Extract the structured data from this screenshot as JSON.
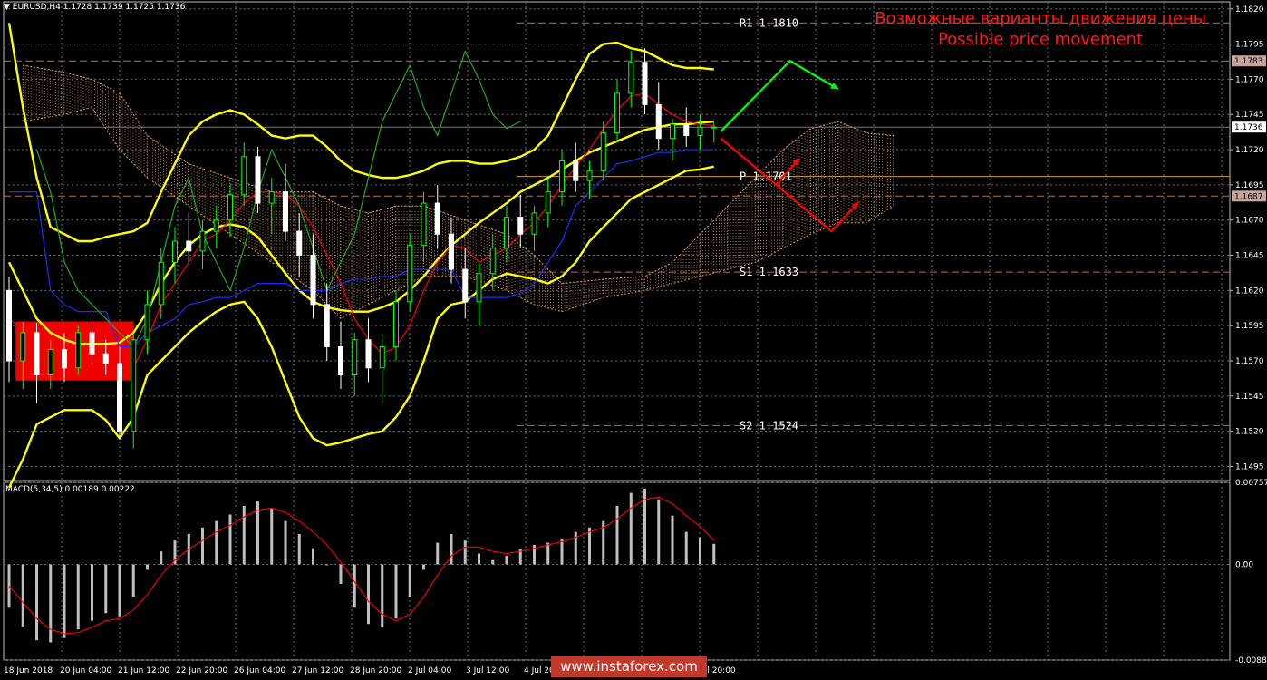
{
  "header": {
    "symbol_line": "EURUSD,H4  1.1728 1.1739 1.1725 1.1736",
    "macd_line": "MACD(5,34,5) 0.00189 0.00222"
  },
  "headline": {
    "ru": "Возможные варианты движения цены",
    "en": "Possible price movement"
  },
  "watermark": "www.instaforex.com",
  "colors": {
    "background": "#000000",
    "bull_candle": "#00ff00",
    "bear_candle": "#ffffff",
    "bollinger": "#ffff00",
    "kijun": "#1e2cff",
    "tenkan": "#ff0000",
    "chikou": "#22aa22",
    "cloud": "#f4a460",
    "pivot_line": "#cc9933",
    "sr_lines": "#b07050",
    "macd_hist": "#bfbfbf",
    "macd_signal": "#ff0000",
    "arrow_up": "#00ff00",
    "arrow_down": "#ff0000",
    "highlight_box": "#ff0000"
  },
  "chart_data": {
    "type": "candlestick",
    "main_axis": {
      "ylim": [
        1.1485,
        1.1825
      ],
      "ticks": [
        "1.1820",
        "1.1795",
        "1.1770",
        "1.1745",
        "1.1720",
        "1.1695",
        "1.1670",
        "1.1645",
        "1.1620",
        "1.1595",
        "1.1570",
        "1.1545",
        "1.1520",
        "1.1495"
      ],
      "current_price": "1.1736",
      "price_tags": [
        "1.1783",
        "1.1687"
      ]
    },
    "macd_axis": {
      "ylim": [
        -0.00883,
        0.00757
      ],
      "ticks": [
        "0.00757",
        "0.00",
        "-0.00883"
      ]
    },
    "x_labels": [
      "18 Jun 2018",
      "20 Jun 04:00",
      "21 Jun 12:00",
      "22 Jun 20:00",
      "26 Jun 04:00",
      "27 Jun 12:00",
      "28 Jun 20:00",
      "2 Jul 04:00",
      "3 Jul 12:00",
      "4 Jul 20",
      "Jul 20:00"
    ],
    "pivots": [
      {
        "label": "R1 1.1810",
        "value": 1.181
      },
      {
        "label": "P  1.1701",
        "value": 1.1701
      },
      {
        "label": "S1 1.1633",
        "value": 1.1633
      },
      {
        "label": "S2 1.1524",
        "value": 1.1524
      }
    ],
    "candles": [
      [
        1.162,
        1.163,
        1.1555,
        1.157
      ],
      [
        1.157,
        1.1598,
        1.155,
        1.159
      ],
      [
        1.159,
        1.1597,
        1.154,
        1.156
      ],
      [
        1.156,
        1.1585,
        1.155,
        1.1578
      ],
      [
        1.1578,
        1.159,
        1.1555,
        1.1565
      ],
      [
        1.1565,
        1.1595,
        1.156,
        1.159
      ],
      [
        1.159,
        1.16,
        1.1568,
        1.1575
      ],
      [
        1.1575,
        1.1585,
        1.156,
        1.1568
      ],
      [
        1.1568,
        1.158,
        1.1515,
        1.152
      ],
      [
        1.152,
        1.159,
        1.1508,
        1.1585
      ],
      [
        1.1585,
        1.162,
        1.1575,
        1.161
      ],
      [
        1.161,
        1.165,
        1.16,
        1.164
      ],
      [
        1.164,
        1.1665,
        1.1625,
        1.1655
      ],
      [
        1.1655,
        1.1675,
        1.164,
        1.1648
      ],
      [
        1.1648,
        1.167,
        1.1635,
        1.1662
      ],
      [
        1.1662,
        1.168,
        1.165,
        1.167
      ],
      [
        1.167,
        1.1695,
        1.1658,
        1.1688
      ],
      [
        1.1688,
        1.1725,
        1.168,
        1.1715
      ],
      [
        1.1715,
        1.1722,
        1.1675,
        1.1682
      ],
      [
        1.1682,
        1.17,
        1.166,
        1.169
      ],
      [
        1.169,
        1.171,
        1.1655,
        1.1662
      ],
      [
        1.1662,
        1.1675,
        1.163,
        1.1645
      ],
      [
        1.1645,
        1.166,
        1.16,
        1.161
      ],
      [
        1.161,
        1.1625,
        1.157,
        1.158
      ],
      [
        1.158,
        1.1598,
        1.155,
        1.156
      ],
      [
        1.156,
        1.159,
        1.1545,
        1.1585
      ],
      [
        1.1585,
        1.16,
        1.1555,
        1.1565
      ],
      [
        1.1565,
        1.1588,
        1.154,
        1.158
      ],
      [
        1.158,
        1.162,
        1.157,
        1.1612
      ],
      [
        1.1612,
        1.166,
        1.1605,
        1.1652
      ],
      [
        1.1652,
        1.169,
        1.164,
        1.1682
      ],
      [
        1.1682,
        1.1695,
        1.165,
        1.166
      ],
      [
        1.166,
        1.1672,
        1.1625,
        1.1635
      ],
      [
        1.1635,
        1.165,
        1.16,
        1.1612
      ],
      [
        1.1612,
        1.164,
        1.1595,
        1.1632
      ],
      [
        1.1632,
        1.166,
        1.162,
        1.165
      ],
      [
        1.165,
        1.168,
        1.164,
        1.1672
      ],
      [
        1.1672,
        1.1688,
        1.165,
        1.166
      ],
      [
        1.166,
        1.168,
        1.1648,
        1.1675
      ],
      [
        1.1675,
        1.17,
        1.1665,
        1.169
      ],
      [
        1.169,
        1.172,
        1.168,
        1.1712
      ],
      [
        1.1712,
        1.1725,
        1.169,
        1.1698
      ],
      [
        1.1698,
        1.1712,
        1.1685,
        1.1705
      ],
      [
        1.1705,
        1.174,
        1.1698,
        1.1732
      ],
      [
        1.1732,
        1.177,
        1.1725,
        1.176
      ],
      [
        1.176,
        1.179,
        1.175,
        1.1782
      ],
      [
        1.1782,
        1.1792,
        1.1745,
        1.1752
      ],
      [
        1.1752,
        1.1768,
        1.172,
        1.1728
      ],
      [
        1.1728,
        1.1742,
        1.1712,
        1.1738
      ],
      [
        1.1738,
        1.175,
        1.1722,
        1.173
      ],
      [
        1.173,
        1.1745,
        1.172,
        1.1736
      ],
      [
        1.1736,
        1.1739,
        1.1725,
        1.1736
      ]
    ],
    "macd_hist": [
      -0.004,
      -0.0058,
      -0.007,
      -0.0072,
      -0.0068,
      -0.006,
      -0.0052,
      -0.0045,
      -0.0048,
      -0.003,
      -0.0005,
      0.0012,
      0.0022,
      0.0028,
      0.0034,
      0.004,
      0.0046,
      0.0054,
      0.0058,
      0.0052,
      0.004,
      0.0028,
      0.0015,
      0.0,
      -0.0018,
      -0.004,
      -0.0055,
      -0.0058,
      -0.005,
      -0.003,
      -0.0005,
      0.002,
      0.0028,
      0.0022,
      0.001,
      0.0004,
      0.0008,
      0.0014,
      0.0018,
      0.002,
      0.0024,
      0.003,
      0.0034,
      0.004,
      0.0054,
      0.0066,
      0.007,
      0.006,
      0.0045,
      0.003,
      0.0025,
      0.0019
    ],
    "macd_signal": [
      -0.002,
      -0.0035,
      -0.005,
      -0.006,
      -0.0064,
      -0.0063,
      -0.0058,
      -0.0052,
      -0.005,
      -0.0042,
      -0.0028,
      -0.001,
      0.0004,
      0.0014,
      0.0022,
      0.003,
      0.0036,
      0.0044,
      0.005,
      0.0052,
      0.0048,
      0.004,
      0.003,
      0.0018,
      0.0002,
      -0.0016,
      -0.0034,
      -0.0046,
      -0.0052,
      -0.0046,
      -0.003,
      -0.001,
      0.0008,
      0.0016,
      0.0016,
      0.0012,
      0.001,
      0.0012,
      0.0015,
      0.0018,
      0.0021,
      0.0025,
      0.003,
      0.0034,
      0.0042,
      0.0052,
      0.006,
      0.0062,
      0.0056,
      0.0045,
      0.0035,
      0.0022
    ],
    "bollinger_upper": [
      1.181,
      1.175,
      1.17,
      1.1665,
      1.166,
      1.1655,
      1.1655,
      1.1658,
      1.166,
      1.1662,
      1.1668,
      1.169,
      1.171,
      1.173,
      1.174,
      1.1745,
      1.1748,
      1.1745,
      1.1738,
      1.173,
      1.1728,
      1.173,
      1.173,
      1.1722,
      1.1712,
      1.1705,
      1.1702,
      1.17,
      1.17,
      1.1702,
      1.1705,
      1.171,
      1.1712,
      1.1712,
      1.171,
      1.171,
      1.1712,
      1.1715,
      1.172,
      1.173,
      1.175,
      1.177,
      1.1788,
      1.1795,
      1.1796,
      1.1792,
      1.179,
      1.1785,
      1.178,
      1.1778,
      1.1778,
      1.1777
    ],
    "bollinger_mid": [
      1.164,
      1.162,
      1.16,
      1.159,
      1.1585,
      1.1582,
      1.1582,
      1.1582,
      1.1583,
      1.159,
      1.1605,
      1.1625,
      1.164,
      1.1652,
      1.166,
      1.1665,
      1.1667,
      1.1665,
      1.1658,
      1.1645,
      1.1632,
      1.162,
      1.1612,
      1.1608,
      1.1606,
      1.1605,
      1.1605,
      1.1608,
      1.1612,
      1.162,
      1.163,
      1.1642,
      1.1652,
      1.166,
      1.1668,
      1.1675,
      1.1682,
      1.169,
      1.1695,
      1.17,
      1.1706,
      1.1712,
      1.1718,
      1.1722,
      1.1726,
      1.173,
      1.1734,
      1.1736,
      1.1738,
      1.1738,
      1.1739,
      1.174
    ],
    "bollinger_lower": [
      1.148,
      1.15,
      1.1525,
      1.153,
      1.1535,
      1.1535,
      1.1535,
      1.1528,
      1.1515,
      1.153,
      1.156,
      1.157,
      1.158,
      1.159,
      1.1598,
      1.1605,
      1.161,
      1.1612,
      1.16,
      1.158,
      1.1555,
      1.153,
      1.1515,
      1.151,
      1.1512,
      1.1515,
      1.1518,
      1.152,
      1.153,
      1.1545,
      1.157,
      1.16,
      1.161,
      1.1612,
      1.162,
      1.1628,
      1.1632,
      1.163,
      1.1628,
      1.1625,
      1.163,
      1.164,
      1.1655,
      1.1665,
      1.1675,
      1.1685,
      1.169,
      1.1695,
      1.17,
      1.1705,
      1.1706,
      1.1708
    ],
    "kijun": [
      1.169,
      1.169,
      1.169,
      1.162,
      1.161,
      1.1605,
      1.1605,
      1.1605,
      1.158,
      1.158,
      1.159,
      1.1595,
      1.16,
      1.161,
      1.1612,
      1.1615,
      1.1615,
      1.162,
      1.1625,
      1.1625,
      1.1625,
      1.162,
      1.162,
      1.162,
      1.1625,
      1.1628,
      1.1628,
      1.163,
      1.163,
      1.1635,
      1.1635,
      1.1635,
      1.1635,
      1.1615,
      1.1615,
      1.1615,
      1.1615,
      1.1618,
      1.1625,
      1.164,
      1.1655,
      1.168,
      1.169,
      1.17,
      1.171,
      1.1712,
      1.1715,
      1.1718,
      1.1718,
      1.172,
      1.172,
      1.172
    ],
    "tenkan": [
      1.16,
      1.1592,
      1.1585,
      1.158,
      1.1575,
      1.1572,
      1.1572,
      1.157,
      1.1555,
      1.1565,
      1.1585,
      1.161,
      1.1625,
      1.164,
      1.1655,
      1.166,
      1.167,
      1.1682,
      1.169,
      1.169,
      1.1688,
      1.168,
      1.1665,
      1.1645,
      1.1625,
      1.16,
      1.1585,
      1.1575,
      1.158,
      1.1595,
      1.162,
      1.164,
      1.1652,
      1.165,
      1.164,
      1.1645,
      1.165,
      1.166,
      1.1668,
      1.168,
      1.1695,
      1.1708,
      1.172,
      1.1735,
      1.1748,
      1.1758,
      1.176,
      1.1752,
      1.1745,
      1.174,
      1.1738,
      1.1737
    ],
    "chikou": [
      1.172,
      1.169,
      1.164,
      1.162,
      1.161,
      1.16,
      1.159,
      1.158,
      1.16,
      1.164,
      1.168,
      1.17,
      1.166,
      1.164,
      1.162,
      1.165,
      1.169,
      1.172,
      1.17,
      1.168,
      1.165,
      1.162,
      1.164,
      1.166,
      1.17,
      1.174,
      1.176,
      1.178,
      1.175,
      1.173,
      1.176,
      1.179,
      1.177,
      1.1745,
      1.1735,
      1.174
    ],
    "cloud": [
      {
        "x": 1,
        "a": 1.178,
        "b": 1.174
      },
      {
        "x": 4,
        "a": 1.1775,
        "b": 1.1745
      },
      {
        "x": 6,
        "a": 1.177,
        "b": 1.175
      },
      {
        "x": 8,
        "a": 1.176,
        "b": 1.172
      },
      {
        "x": 10,
        "a": 1.173,
        "b": 1.17
      },
      {
        "x": 13,
        "a": 1.171,
        "b": 1.168
      },
      {
        "x": 16,
        "a": 1.17,
        "b": 1.166
      },
      {
        "x": 19,
        "a": 1.169,
        "b": 1.164
      },
      {
        "x": 22,
        "a": 1.169,
        "b": 1.162
      },
      {
        "x": 24,
        "a": 1.168,
        "b": 1.16
      },
      {
        "x": 26,
        "a": 1.1675,
        "b": 1.161
      },
      {
        "x": 28,
        "a": 1.168,
        "b": 1.162
      },
      {
        "x": 30,
        "a": 1.168,
        "b": 1.163
      },
      {
        "x": 33,
        "a": 1.167,
        "b": 1.163
      },
      {
        "x": 36,
        "a": 1.166,
        "b": 1.162
      },
      {
        "x": 38,
        "a": 1.1645,
        "b": 1.161
      },
      {
        "x": 40,
        "a": 1.1625,
        "b": 1.1605
      },
      {
        "x": 43,
        "a": 1.1628,
        "b": 1.1615
      },
      {
        "x": 46,
        "a": 1.163,
        "b": 1.162
      },
      {
        "x": 48,
        "a": 1.164,
        "b": 1.1625
      },
      {
        "x": 50,
        "a": 1.166,
        "b": 1.163
      },
      {
        "x": 52,
        "a": 1.168,
        "b": 1.1635
      },
      {
        "x": 54,
        "a": 1.17,
        "b": 1.164
      },
      {
        "x": 56,
        "a": 1.172,
        "b": 1.165
      },
      {
        "x": 58,
        "a": 1.1735,
        "b": 1.166
      },
      {
        "x": 60,
        "a": 1.174,
        "b": 1.1668
      },
      {
        "x": 62,
        "a": 1.1732,
        "b": 1.1668
      },
      {
        "x": 64,
        "a": 1.173,
        "b": 1.168
      }
    ],
    "arrows": [
      {
        "color": "up",
        "points": [
          [
            51.5,
            1.1733
          ],
          [
            56.5,
            1.1783
          ],
          [
            60,
            1.1763
          ]
        ]
      },
      {
        "color": "down",
        "points": [
          [
            51.5,
            1.1728
          ],
          [
            55.5,
            1.1695
          ],
          [
            57.2,
            1.1714
          ]
        ]
      },
      {
        "color": "down",
        "points": [
          [
            55.5,
            1.1695
          ],
          [
            59.5,
            1.1662
          ],
          [
            61.5,
            1.1683
          ]
        ]
      }
    ],
    "highlight_box": {
      "x0": 1,
      "x1": 8.5,
      "y0": 1.1598,
      "y1": 1.1556
    }
  }
}
